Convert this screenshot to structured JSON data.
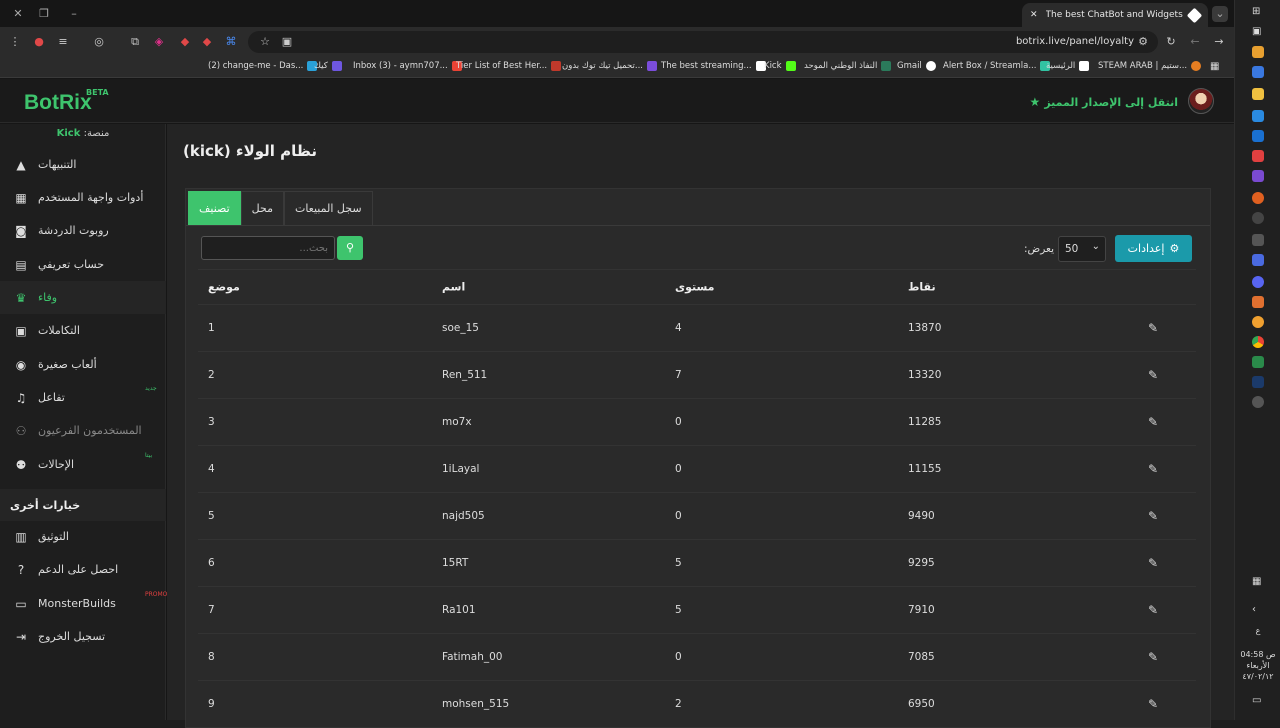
{
  "browser": {
    "tab_title": "The best ChatBot and Widgets",
    "url": "botrix.live/panel/loyalty",
    "bookmarks": [
      {
        "label": "(2) change-me - Das...",
        "color": "#2aa1d8"
      },
      {
        "label": "كيك",
        "color": "#6e57e0"
      },
      {
        "label": "Inbox (3) - aymn707...",
        "color": "#ea4335"
      },
      {
        "label": "Tier List of Best Her...",
        "color": "#c0392b"
      },
      {
        "label": "تحميل تيك توك بدون...",
        "color": "#7b4ddb"
      },
      {
        "label": "The best streaming...",
        "color": "#ffffff"
      },
      {
        "label": "Kick",
        "color": "#53fc18"
      },
      {
        "label": "النفاذ الوطني الموحد",
        "color": "#2b7a5b"
      },
      {
        "label": "Gmail",
        "color": "#ffffff"
      },
      {
        "label": "Alert Box / Streamla...",
        "color": "#31c3a2"
      },
      {
        "label": "الرئيسية",
        "color": "#ffffff"
      },
      {
        "label": "STEAM ARAB | ستيم...",
        "color": "#e67e22"
      }
    ]
  },
  "app": {
    "logo": "BotRix",
    "beta": "BETA",
    "premium_link": "انتقل إلى الإصدار المميز",
    "platform_label": "منصة:",
    "platform_value": "Kick"
  },
  "sidebar": {
    "items": [
      {
        "label": "التنبيهات",
        "icon": "alert-icon",
        "glyph": "▲",
        "state": "normal"
      },
      {
        "label": "أدوات واجهة المستخدم",
        "icon": "widgets-icon",
        "glyph": "▦",
        "state": "normal"
      },
      {
        "label": "روبوت الدردشة",
        "icon": "robot-icon",
        "glyph": "◙",
        "state": "normal"
      },
      {
        "label": "حساب تعريفي",
        "icon": "id-card-icon",
        "glyph": "▤",
        "state": "normal"
      },
      {
        "label": "وفاء",
        "icon": "trophy-icon",
        "glyph": "♛",
        "state": "active"
      },
      {
        "label": "التكاملات",
        "icon": "integrations-icon",
        "glyph": "▣",
        "state": "normal"
      },
      {
        "label": "ألعاب صغيرة",
        "icon": "gamepad-icon",
        "glyph": "◉",
        "state": "normal"
      },
      {
        "label": "تفاعل",
        "icon": "music-icon",
        "glyph": "♫",
        "state": "normal",
        "badge": "جديد"
      },
      {
        "label": "المستخدمون الفرعيون",
        "icon": "users-icon",
        "glyph": "⚇",
        "state": "disabled"
      },
      {
        "label": "الإحالات",
        "icon": "referrals-icon",
        "glyph": "⚉",
        "state": "normal",
        "badge": "بيتا"
      }
    ],
    "section_title": "خيارات أخرى",
    "other_items": [
      {
        "label": "التوثيق",
        "icon": "book-icon",
        "glyph": "▥"
      },
      {
        "label": "احصل على الدعم",
        "icon": "help-icon",
        "glyph": "?"
      },
      {
        "label": "MonsterBuilds",
        "icon": "laptop-icon",
        "glyph": "▭",
        "badge": "PROMO"
      },
      {
        "label": "تسجيل الخروج",
        "icon": "logout-icon",
        "glyph": "⇥"
      }
    ]
  },
  "main": {
    "title": "نظام الولاء (kick)",
    "tabs": [
      {
        "label": "تصنيف",
        "active": true
      },
      {
        "label": "محل",
        "active": false
      },
      {
        "label": "سجل المبيعات",
        "active": false
      }
    ],
    "search_placeholder": "بحث...",
    "show_label": "يعرض:",
    "show_value": "50",
    "settings_label": "إعدادات",
    "table": {
      "headers": {
        "position": "موضع",
        "name": "اسم",
        "level": "مستوى",
        "points": "نقاط"
      },
      "rows": [
        {
          "position": "1",
          "name": "soe_15",
          "level": "4",
          "points": "13870"
        },
        {
          "position": "2",
          "name": "Ren_511",
          "level": "7",
          "points": "13320"
        },
        {
          "position": "3",
          "name": "mo7x",
          "level": "0",
          "points": "11285"
        },
        {
          "position": "4",
          "name": "1iLayal",
          "level": "0",
          "points": "11155"
        },
        {
          "position": "5",
          "name": "najd505",
          "level": "0",
          "points": "9490"
        },
        {
          "position": "6",
          "name": "15RT",
          "level": "5",
          "points": "9295"
        },
        {
          "position": "7",
          "name": "Ra101",
          "level": "5",
          "points": "7910"
        },
        {
          "position": "8",
          "name": "Fatimah_00",
          "level": "0",
          "points": "7085"
        },
        {
          "position": "9",
          "name": "mohsen_515",
          "level": "2",
          "points": "6950"
        }
      ]
    }
  },
  "taskbar": {
    "time": "04:58 ص",
    "day": "الأربعاء",
    "date": "٤٧/٠٢/١٢",
    "lang": "ع"
  }
}
